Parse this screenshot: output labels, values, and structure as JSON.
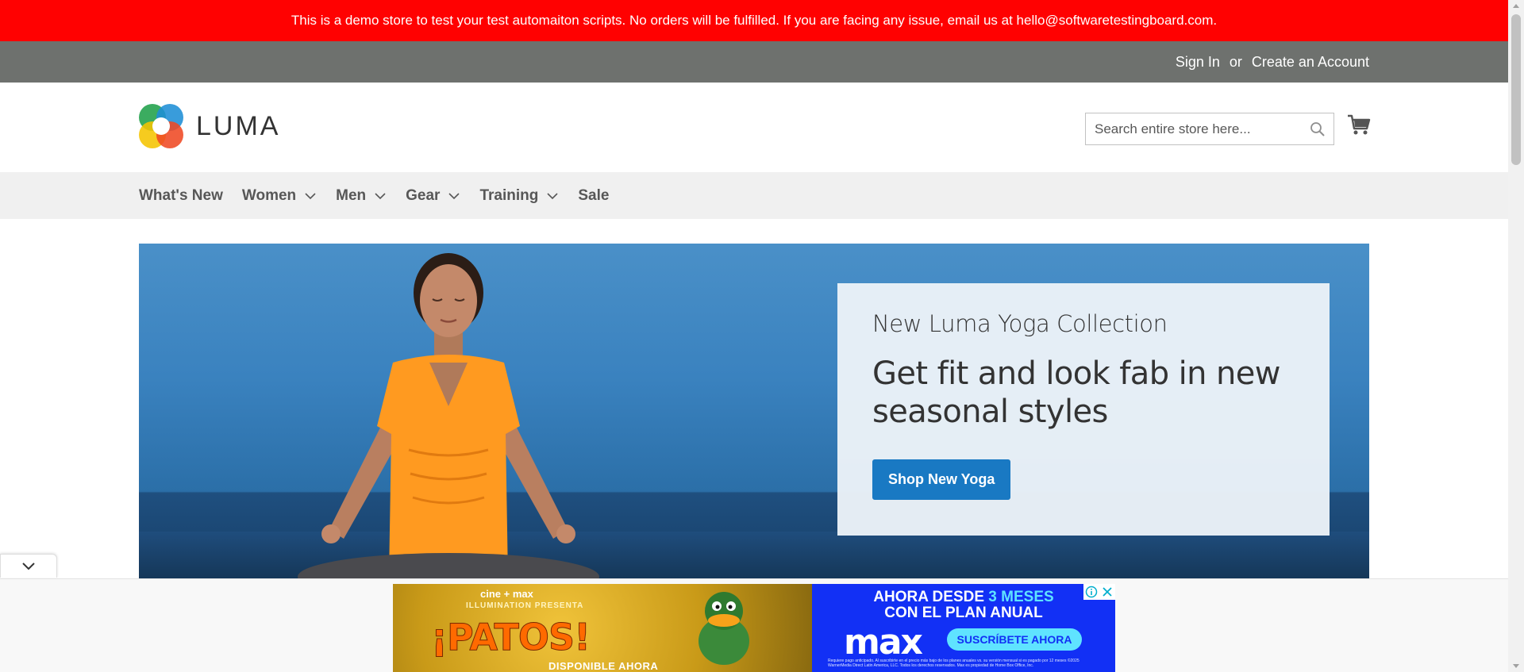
{
  "notice": {
    "text": "This is a demo store to test your test automaiton scripts. No orders will be fulfilled. If you are facing any issue, email us at hello@softwaretestingboard.com."
  },
  "panel": {
    "sign_in": "Sign In",
    "or": "or",
    "create_account": "Create an Account"
  },
  "header": {
    "logo_text": "LUMA",
    "search_placeholder": "Search entire store here...",
    "search_value": "",
    "search_icon": "search-icon",
    "cart_icon": "cart-icon"
  },
  "nav": {
    "items": [
      {
        "label": "What's New",
        "has_dropdown": false
      },
      {
        "label": "Women",
        "has_dropdown": true
      },
      {
        "label": "Men",
        "has_dropdown": true
      },
      {
        "label": "Gear",
        "has_dropdown": true
      },
      {
        "label": "Training",
        "has_dropdown": true
      },
      {
        "label": "Sale",
        "has_dropdown": false
      }
    ]
  },
  "hero": {
    "subtitle": "New Luma Yoga Collection",
    "title": "Get fit and look fab in new seasonal styles",
    "button": "Shop New Yoga"
  },
  "ad": {
    "brand": "cine + max",
    "studio": "ILLUMINATION PRESENTA",
    "movie": "¡PATOS!",
    "available": "DISPONIBLE AHORA",
    "offer_line1": "AHORA DESDE",
    "offer_highlight": "3 MESES",
    "offer_line2": "CON EL PLAN ANUAL",
    "logo": "max",
    "cta": "SUSCRÍBETE AHORA",
    "fine_print": "Requiere pago anticipado. Al suscribirte en el precio más bajo de los planes anuales vs. su versión mensual si es pagado por 12 meses ©2025 WarnerMedia Direct Latin America, LLC. Todos los derechos reservados. Max es propiedad de Home Box Office, Inc."
  },
  "colors": {
    "notice_bg": "#ff0101",
    "panel_bg": "#6e716e",
    "nav_bg": "#f0f0f0",
    "primary_button": "#1979c3"
  }
}
